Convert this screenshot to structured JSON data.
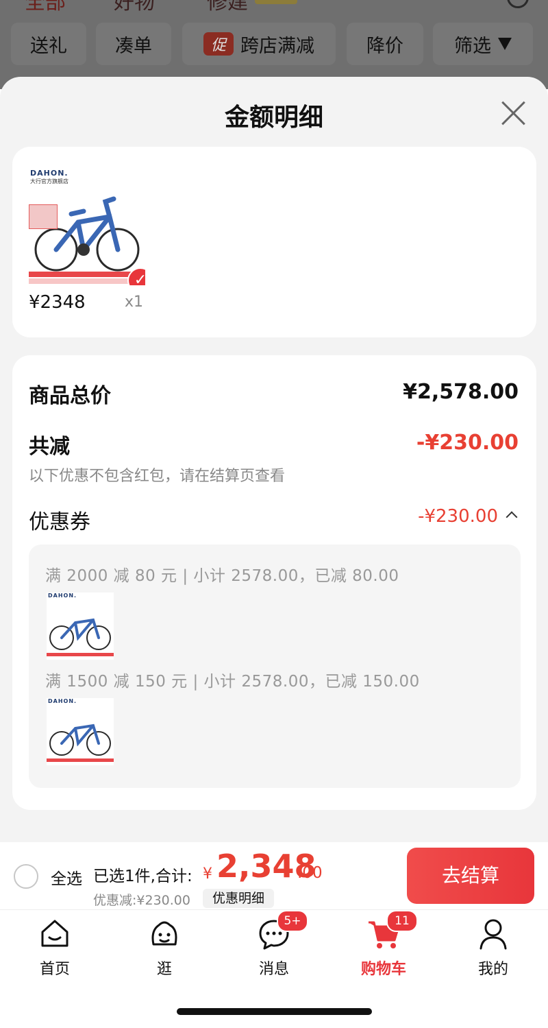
{
  "top_tabs": [
    "全部",
    "好物",
    "修建"
  ],
  "filter_chips": {
    "gift": "送礼",
    "bundle": "凑单",
    "promo_tag": "促",
    "cross_store": "跨店满减",
    "price_drop": "降价",
    "filter": "筛选"
  },
  "sheet": {
    "title": "金额明细"
  },
  "product": {
    "brand": "DAHON.",
    "store": "大行官方旗舰店",
    "price": "¥2348",
    "qty": "x1"
  },
  "breakdown": {
    "total_label": "商品总价",
    "total_value": "¥2,578.00",
    "reduce_label": "共减",
    "reduce_value": "-¥230.00",
    "note": "以下优惠不包含红包，请在结算页查看",
    "coupon_label": "优惠券",
    "coupon_value": "-¥230.00",
    "coupons": [
      "满 2000 减 80 元 | 小计 2578.00，已减 80.00",
      "满 1500 减 150 元 | 小计 2578.00，已减 150.00"
    ]
  },
  "checkout": {
    "select_all": "全选",
    "selected_summary": "已选1件,合计:",
    "currency": "¥",
    "total_int": "2,348",
    "total_dec": ".00",
    "discount": "优惠减:¥230.00",
    "detail_button": "优惠明细",
    "checkout_button": "去结算"
  },
  "tabbar": {
    "items": [
      {
        "label": "首页",
        "icon": "home-icon"
      },
      {
        "label": "逛",
        "icon": "explore-icon"
      },
      {
        "label": "消息",
        "icon": "message-icon",
        "badge": "5+"
      },
      {
        "label": "购物车",
        "icon": "cart-icon",
        "badge": "11",
        "active": true
      },
      {
        "label": "我的",
        "icon": "profile-icon"
      }
    ]
  },
  "colors": {
    "accent": "#e8363b",
    "price_red": "#e84033",
    "muted": "#888888"
  }
}
